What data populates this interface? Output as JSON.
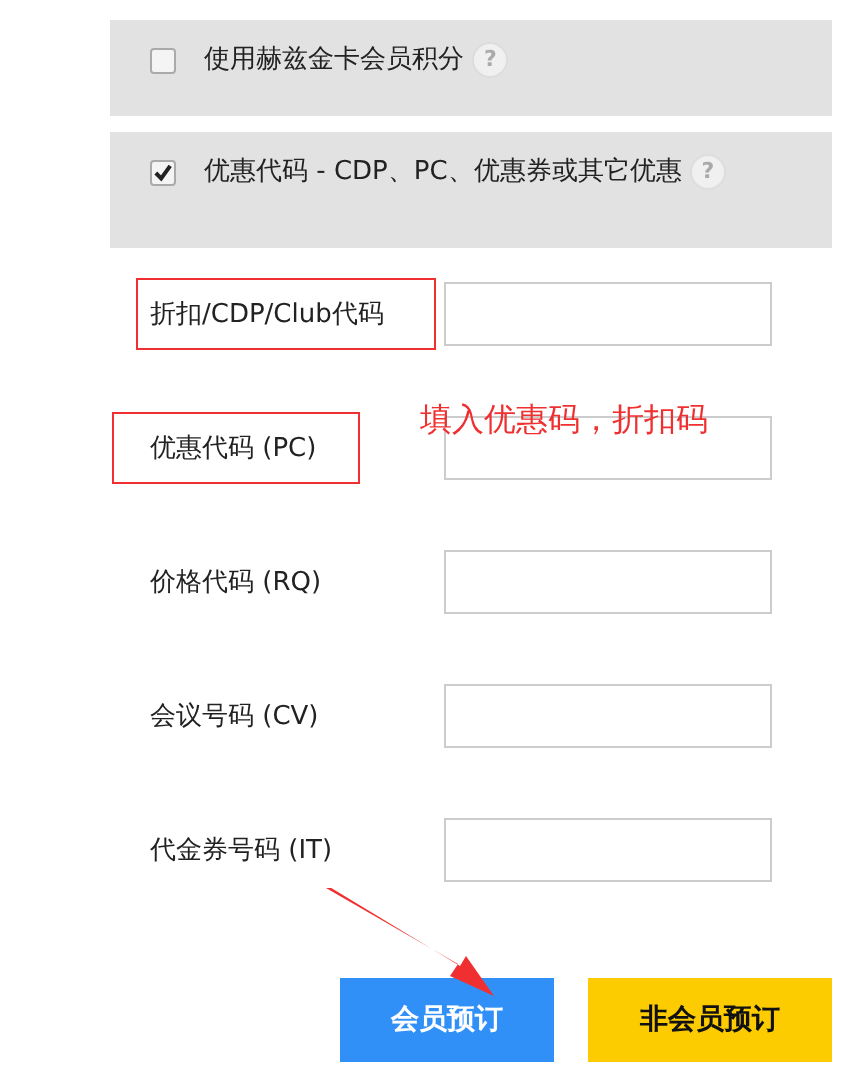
{
  "options": [
    {
      "label": "使用赫兹金卡会员积分",
      "checked": false,
      "help": "?"
    },
    {
      "label": "优惠代码 - CDP、PC、优惠券或其它优惠",
      "checked": true,
      "help": "?"
    }
  ],
  "fields": [
    {
      "label": "折扣/CDP/Club代码",
      "highlighted": true
    },
    {
      "label": "优惠代码 (PC)",
      "highlighted": true
    },
    {
      "label": "价格代码 (RQ)",
      "highlighted": false
    },
    {
      "label": "会议号码 (CV)",
      "highlighted": false
    },
    {
      "label": "代金券号码 (IT)",
      "highlighted": false
    }
  ],
  "annotation": "填入优惠码，折扣码",
  "buttons": [
    {
      "label": "会员预订",
      "kind": "primary"
    },
    {
      "label": "非会员预订",
      "kind": "secondary"
    }
  ]
}
